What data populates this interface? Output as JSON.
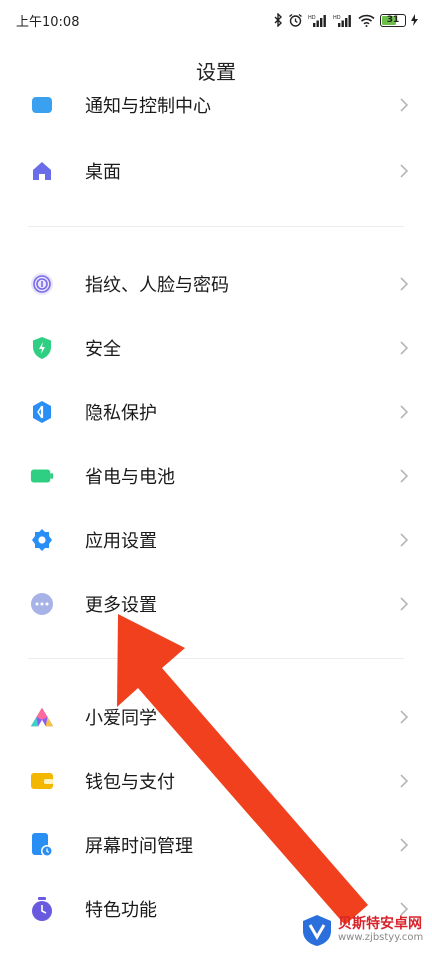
{
  "status": {
    "time": "上午10:08",
    "battery": "31"
  },
  "title": "设置",
  "rows": [
    {
      "label": "通知与控制中心",
      "icon": "notification-icon",
      "color": "#3aa0f0"
    },
    {
      "label": "桌面",
      "icon": "home-icon",
      "color": "#6a6ce8"
    },
    {
      "label": "指纹、人脸与密码",
      "icon": "fingerprint-icon",
      "color": "#7a6ae6"
    },
    {
      "label": "安全",
      "icon": "shield-icon",
      "color": "#2fcf83"
    },
    {
      "label": "隐私保护",
      "icon": "privacy-icon",
      "color": "#2a8ff5"
    },
    {
      "label": "省电与电池",
      "icon": "battery-icon",
      "color": "#2fcf83"
    },
    {
      "label": "应用设置",
      "icon": "gear-icon",
      "color": "#2a8ff5"
    },
    {
      "label": "更多设置",
      "icon": "more-icon",
      "color": "#a7b3e6"
    },
    {
      "label": "小爱同学",
      "icon": "xiaoai-icon",
      "color": "#8b5cf6"
    },
    {
      "label": "钱包与支付",
      "icon": "wallet-icon",
      "color": "#f3b700"
    },
    {
      "label": "屏幕时间管理",
      "icon": "screen-time-icon",
      "color": "#2a8ff5"
    },
    {
      "label": "特色功能",
      "icon": "feature-icon",
      "color": "#6a5ae0"
    }
  ],
  "watermark": {
    "name": "贝斯特安卓网",
    "url": "www.zjbstyy.com"
  },
  "annotation": {
    "color": "#f0401e"
  }
}
